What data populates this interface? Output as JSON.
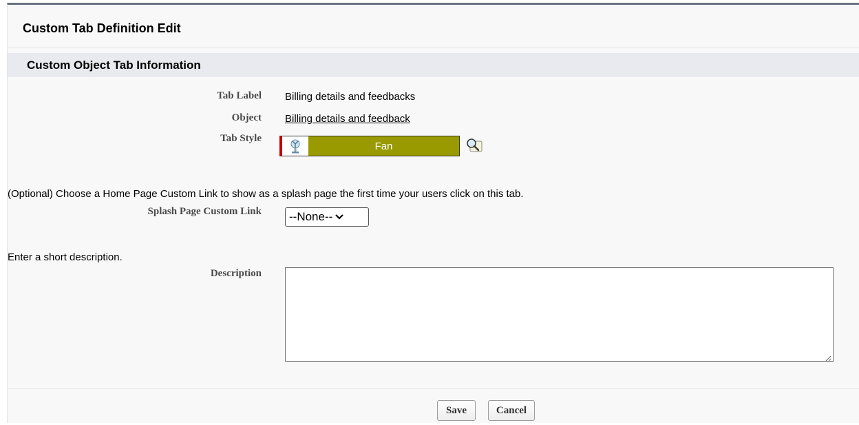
{
  "page_title": "Custom Tab Definition Edit",
  "section_title": "Custom Object Tab Information",
  "fields": {
    "tab_label": {
      "label": "Tab Label",
      "value": "Billing details and feedbacks"
    },
    "object": {
      "label": "Object",
      "value": "Billing details and feedback"
    },
    "tab_style": {
      "label": "Tab Style",
      "value": "Fan",
      "swatch_color": "#999900",
      "accent_color": "#c00000",
      "icon": "fan-icon"
    },
    "splash_note": "(Optional) Choose a Home Page Custom Link to show as a splash page the first time your users click on this tab.",
    "splash_link": {
      "label": "Splash Page Custom Link",
      "selected": "--None--"
    },
    "description_note": "Enter a short description.",
    "description": {
      "label": "Description",
      "value": ""
    }
  },
  "buttons": {
    "save": "Save",
    "cancel": "Cancel"
  },
  "icons": {
    "lookup": "lookup-magnifier-icon",
    "dropdown": "chevron-down-icon",
    "resize": "resize-grip-icon"
  }
}
